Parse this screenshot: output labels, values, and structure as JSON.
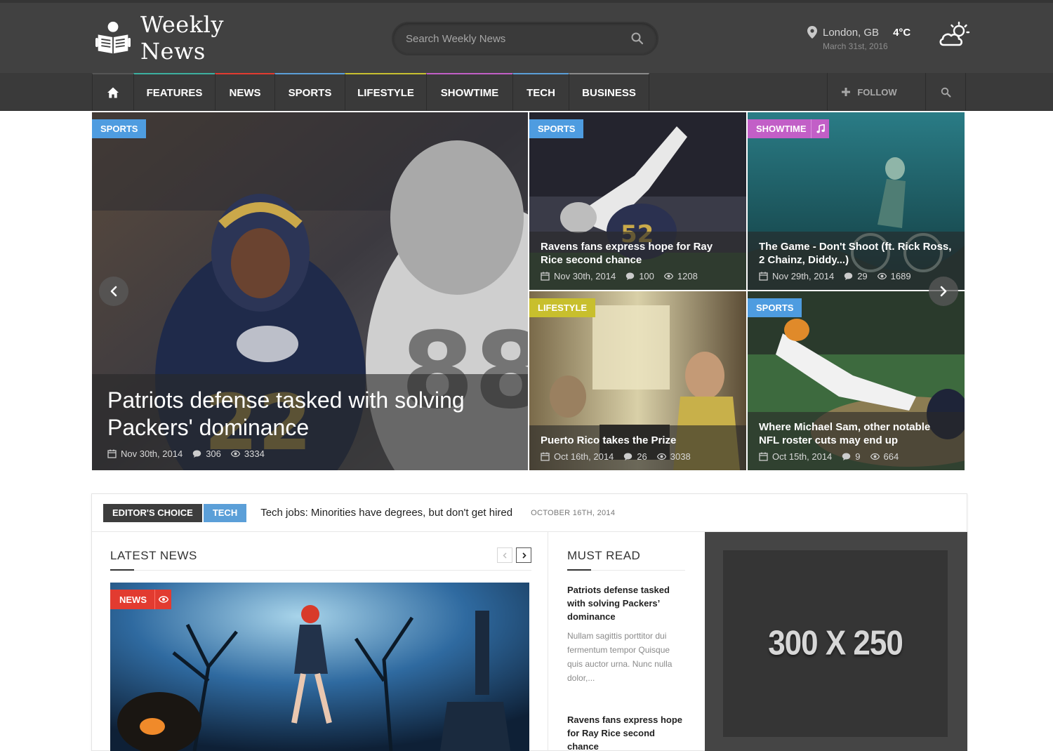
{
  "header": {
    "site_name": "Weekly News",
    "search_placeholder": "Search Weekly News",
    "location": "London, GB",
    "temperature": "4°C",
    "date": "March 31st, 2016",
    "weather_icon": "partly-cloudy-icon"
  },
  "nav": {
    "items": [
      {
        "label": "FEATURES",
        "color": "#3cb0a0"
      },
      {
        "label": "NEWS",
        "color": "#e23b30"
      },
      {
        "label": "SPORTS",
        "color": "#5b9fd8"
      },
      {
        "label": "LIFESTYLE",
        "color": "#c8c030"
      },
      {
        "label": "SHOWTIME",
        "color": "#c25fc7"
      },
      {
        "label": "TECH",
        "color": "#5b9fd8"
      },
      {
        "label": "BUSINESS",
        "color": "#8a8a8a"
      }
    ],
    "follow_label": "FOLLOW"
  },
  "featured": {
    "main": {
      "category": "SPORTS",
      "category_color": "#4e9ce0",
      "title": "Patriots defense tasked with solving Packers' dominance",
      "date": "Nov 30th, 2014",
      "comments": "306",
      "views": "3334"
    },
    "tiles": [
      {
        "category": "SPORTS",
        "category_color": "#4e9ce0",
        "title": "Ravens fans express hope for Ray Rice second chance",
        "date": "Nov 30th, 2014",
        "comments": "100",
        "views": "1208"
      },
      {
        "category": "SHOWTIME",
        "category_color": "#c25fc7",
        "title": "The Game - Don't Shoot (ft. Rick Ross, 2 Chainz, Diddy...)",
        "date": "Nov 29th, 2014",
        "comments": "29",
        "views": "1689"
      },
      {
        "category": "LIFESTYLE",
        "category_color": "#c8bf2d",
        "title": "Puerto Rico takes the Prize",
        "date": "Oct 16th, 2014",
        "comments": "26",
        "views": "3038"
      },
      {
        "category": "SPORTS",
        "category_color": "#4e9ce0",
        "title": "Where Michael Sam, other notable NFL roster cuts may end up",
        "date": "Oct 15th, 2014",
        "comments": "9",
        "views": "664"
      }
    ]
  },
  "ticker": {
    "label": "EDITOR'S CHOICE",
    "category": "TECH",
    "title": "Tech jobs: Minorities have degrees, but don't get hired",
    "date": "OCTOBER 16TH, 2014"
  },
  "latest": {
    "title": "LATEST NEWS",
    "badge": "NEWS"
  },
  "must_read": {
    "title": "MUST READ",
    "items": [
      {
        "title": "Patriots defense tasked with solving Packers’ dominance",
        "excerpt": "Nullam sagittis porttitor dui fermentum tempor Quisque quis auctor urna. Nunc nulla dolor,..."
      },
      {
        "title": "Ravens fans express hope for Ray Rice second chance",
        "excerpt": ""
      }
    ]
  },
  "ad": {
    "label": "300 X 250"
  }
}
